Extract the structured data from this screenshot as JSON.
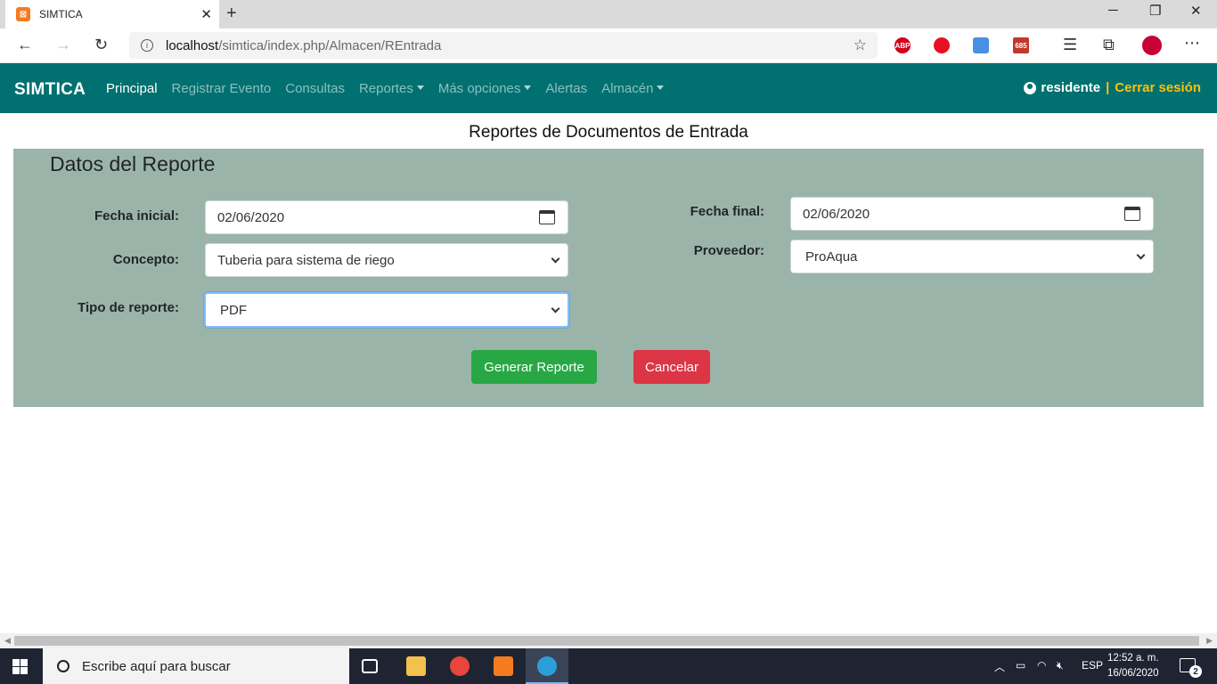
{
  "browser": {
    "tab_title": "SIMTICA",
    "url_host": "localhost",
    "url_path": "/simtica/index.php/Almacen/REntrada",
    "extensions": [
      {
        "name": "adblock-plus",
        "label": "ABP",
        "color": "#d0021b"
      },
      {
        "name": "opera-like-red",
        "label": "",
        "color": "#e81123"
      },
      {
        "name": "translate",
        "label": "",
        "color": "#4a90e2"
      },
      {
        "name": "gmail-checker",
        "label": "685",
        "color": "#c0392b"
      },
      {
        "name": "debian-swirl",
        "label": "",
        "color": "#c70036"
      }
    ]
  },
  "navbar": {
    "brand": "SIMTICA",
    "items": [
      {
        "label": "Principal",
        "active": true,
        "dropdown": false
      },
      {
        "label": "Registrar Evento",
        "active": false,
        "dropdown": false
      },
      {
        "label": "Consultas",
        "active": false,
        "dropdown": false
      },
      {
        "label": "Reportes",
        "active": false,
        "dropdown": true
      },
      {
        "label": "Más opciones",
        "active": false,
        "dropdown": true
      },
      {
        "label": "Alertas",
        "active": false,
        "dropdown": false
      },
      {
        "label": "Almacén",
        "active": false,
        "dropdown": true
      }
    ],
    "user": "residente",
    "separator": "|",
    "logout": "Cerrar sesión",
    "colors": {
      "background": "#007070",
      "logout": "#ffc107"
    }
  },
  "page": {
    "title": "Reportes de Documentos de Entrada",
    "panel_title": "Datos del Reporte",
    "form": {
      "fecha_inicial_label": "Fecha inicial:",
      "fecha_inicial_value": "02/06/2020",
      "fecha_final_label": "Fecha final:",
      "fecha_final_value": "02/06/2020",
      "concepto_label": "Concepto:",
      "concepto_value": "Tuberia para sistema de riego",
      "proveedor_label": "Proveedor:",
      "proveedor_value": "ProAqua",
      "tipo_label": "Tipo de reporte:",
      "tipo_value": "PDF"
    },
    "buttons": {
      "generate": "Generar Reporte",
      "cancel": "Cancelar"
    },
    "colors": {
      "panel": "#9bb4aa",
      "generate": "#28a745",
      "cancel": "#dc3545"
    }
  },
  "taskbar": {
    "search_placeholder": "Escribe aquí para buscar",
    "language": "ESP",
    "time": "12:52 a. m.",
    "date": "16/06/2020",
    "notifications": "2"
  }
}
